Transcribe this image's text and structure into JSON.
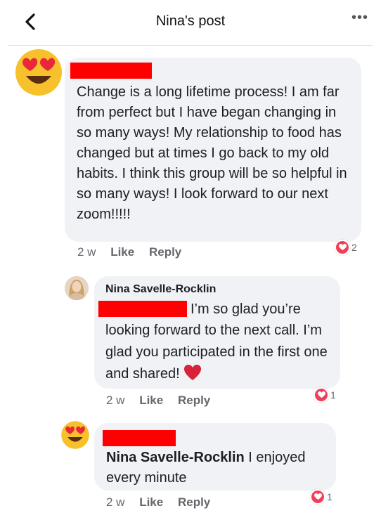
{
  "header": {
    "title": "Nina's post",
    "more_label": "•••"
  },
  "comments": [
    {
      "text": "Change is a long lifetime process! I am far from perfect but I have began changing in so many ways! My relationship to food has changed but at times I go back to my old habits. I think this group will be so helpful in so many ways! I look forward to our next zoom!!!!!",
      "time": "2 w",
      "like": "Like",
      "reply": "Reply",
      "reactions": "2"
    },
    {
      "author": "Nina Savelle-Rocklin",
      "text_line1": "I’m so glad you’re",
      "text_rest": "looking forward to the next call. I’m glad you participated in the first one and shared!",
      "time": "2 w",
      "like": "Like",
      "reply": "Reply",
      "reactions": "1"
    },
    {
      "mention": "Nina Savelle-Rocklin",
      "text": " I enjoyed every minute",
      "time": "2 w",
      "like": "Like",
      "reply": "Reply",
      "reactions": "1"
    }
  ],
  "colors": {
    "redaction": "#ff0000",
    "bubble": "#f0f2f5",
    "reaction": "#f33e58",
    "heart": "#d8233a"
  }
}
